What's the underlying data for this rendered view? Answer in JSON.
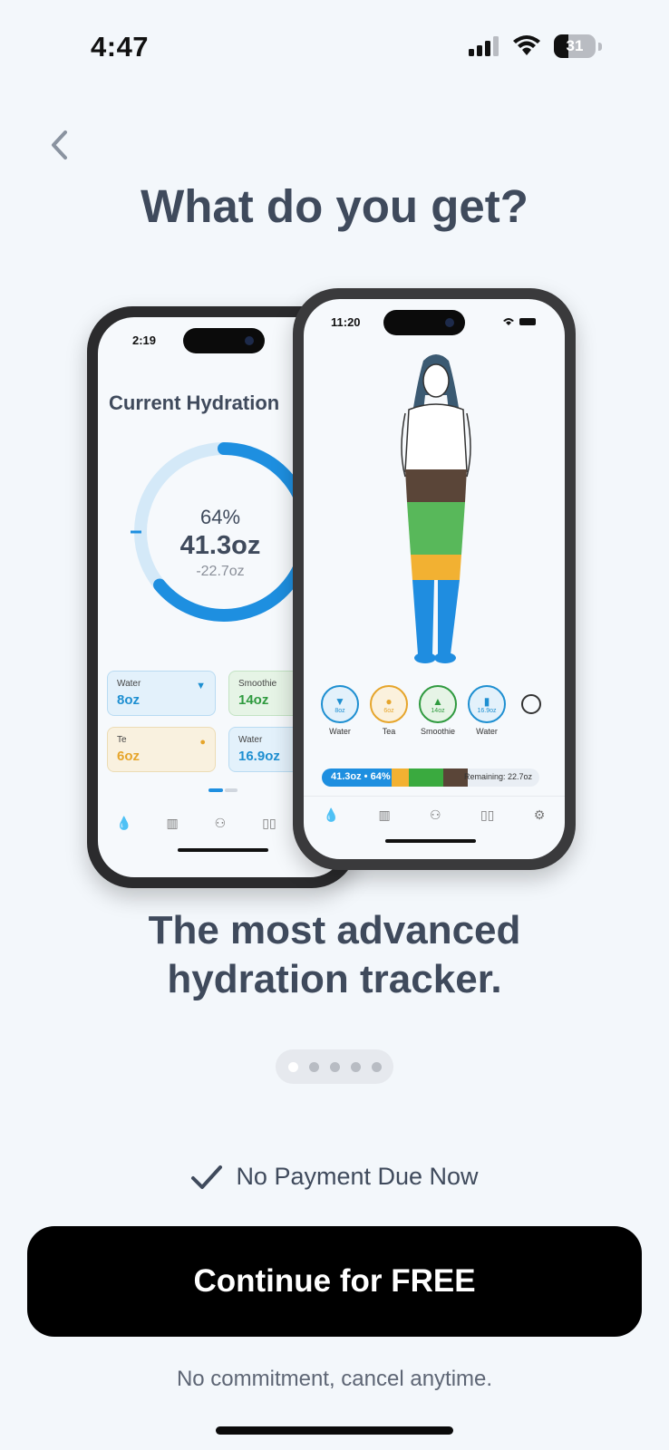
{
  "status_bar": {
    "time": "4:47",
    "battery": "31"
  },
  "headline": "What do you get?",
  "preview_back": {
    "time": "2:19",
    "title": "Current Hydration",
    "percent": "64%",
    "amount": "41.3oz",
    "remaining": "-22.7oz",
    "progress": 0.64,
    "cards": [
      {
        "name": "Water",
        "amount": "8oz",
        "color": "#1e8fd1"
      },
      {
        "name": "Smoothie",
        "amount": "14oz",
        "color": "#2f9a3f"
      },
      {
        "name": "Te",
        "amount": "6oz",
        "color": "#e6a52b"
      },
      {
        "name": "Water",
        "amount": "16.9oz",
        "color": "#1e8fd1"
      }
    ]
  },
  "preview_front": {
    "time": "11:20",
    "drinks": [
      {
        "name": "Water",
        "amount": "8oz",
        "color": "#1e8fd1"
      },
      {
        "name": "Tea",
        "amount": "6oz",
        "color": "#e6a52b"
      },
      {
        "name": "Smoothie",
        "amount": "14oz",
        "color": "#2f9a3f"
      },
      {
        "name": "Water",
        "amount": "16.9oz",
        "color": "#1e8fd1"
      }
    ],
    "progress_label": "41.3oz • 64%",
    "remaining_label": "Remaining: 22.7oz"
  },
  "tagline_line1": "The most advanced",
  "tagline_line2": "hydration tracker.",
  "pager": {
    "count": 5,
    "active": 0
  },
  "no_payment": "No Payment Due Now",
  "cta_label": "Continue for FREE",
  "fine_print": "No commitment, cancel anytime."
}
